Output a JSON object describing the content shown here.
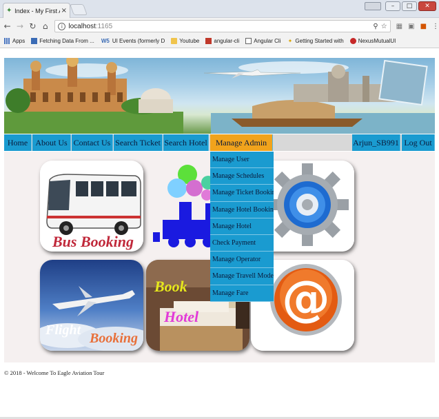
{
  "browser": {
    "tab_title": "Index - My First Applicati",
    "tab_close": "×",
    "url_host": "localhost",
    "url_port": ":1165",
    "bookmarks": [
      {
        "label": "Apps",
        "icon": "apps-icon"
      },
      {
        "label": "Fetching Data From ...",
        "icon": "fetch-icon"
      },
      {
        "label": "UI Events (formerly D",
        "icon": "ws-icon"
      },
      {
        "label": "Youtube",
        "icon": "folder-icon"
      },
      {
        "label": "angular-cli",
        "icon": "mail-icon"
      },
      {
        "label": "Angular Cli",
        "icon": "doc-icon"
      },
      {
        "label": "Getting Started with",
        "icon": "angular-icon"
      },
      {
        "label": "NexusMutualUI",
        "icon": "nexus-icon"
      }
    ]
  },
  "navbar": {
    "items": [
      "Home",
      "About Us",
      "Contact Us",
      "Search Ticket",
      "Search Hotel",
      "Manage Admin"
    ],
    "user": "Arjun_SB991",
    "logout": "Log Out",
    "active_color": "#f1a31c",
    "bar_color": "#1a9bd0"
  },
  "admin_menu": {
    "items": [
      "Manage User",
      "Manage Schedules",
      "Manage Ticket Booking",
      "Manage Hotel Booking",
      "Manage Hotel",
      "Check Payment",
      "Manage Operator",
      "Manage Travell Mode",
      "Manage Fare"
    ]
  },
  "tiles": {
    "bus": "Bus Booking",
    "flight_1": "Flight",
    "flight_2": "Booking",
    "hotel_1": "Book",
    "hotel_2": "Hotel",
    "email_glyph": "@"
  },
  "footer": "© 2018 - Welcome To Eagle Aviation Tour"
}
